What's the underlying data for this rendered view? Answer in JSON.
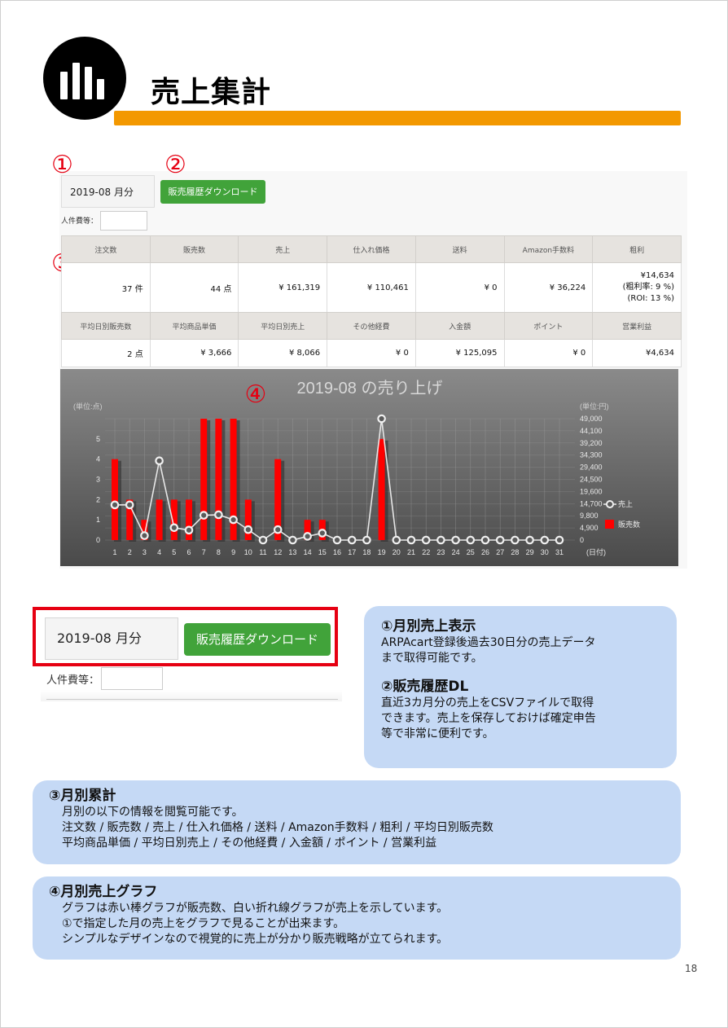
{
  "page": {
    "title": "売上集計",
    "page_number": "18"
  },
  "markers": [
    "①",
    "②",
    "③",
    "④"
  ],
  "ui": {
    "month_label": "2019-08 月分",
    "download_label": "販売履歴ダウンロード",
    "person_cost_label": "人件費等："
  },
  "stats_row1": {
    "headers": [
      "注文数",
      "販売数",
      "売上",
      "仕入れ価格",
      "送料",
      "Amazon手数料",
      "粗利"
    ],
    "values": [
      "37 件",
      "44 点",
      "¥ 161,319",
      "¥ 110,461",
      "¥ 0",
      "¥ 36,224",
      "¥14,634"
    ],
    "gross_profit_rate": "(粗利率: 9 %)",
    "roi": "(ROI: 13 %)"
  },
  "stats_row2": {
    "headers": [
      "平均日別販売数",
      "平均商品単価",
      "平均日別売上",
      "その他経費",
      "入金額",
      "ポイント",
      "営業利益"
    ],
    "values": [
      "2 点",
      "¥ 3,666",
      "¥ 8,066",
      "¥ 0",
      "¥ 125,095",
      "¥ 0",
      "¥4,634"
    ]
  },
  "chart_data": {
    "type": "bar",
    "title": "2019-08 の売り上げ",
    "left_axis_unit": "(単位:点)",
    "right_axis_unit": "(単位:円)",
    "xlabel": "(日付)",
    "categories": [
      "1",
      "2",
      "3",
      "4",
      "5",
      "6",
      "7",
      "8",
      "9",
      "10",
      "11",
      "12",
      "13",
      "14",
      "15",
      "16",
      "17",
      "18",
      "19",
      "20",
      "21",
      "22",
      "23",
      "24",
      "25",
      "26",
      "27",
      "28",
      "29",
      "30",
      "31"
    ],
    "left_ticks": [
      "0",
      "1",
      "2",
      "3",
      "4",
      "5"
    ],
    "right_ticks": [
      "0",
      "4,900",
      "9,800",
      "14,700",
      "19,600",
      "24,500",
      "29,400",
      "34,300",
      "39,200",
      "44,100",
      "49,000"
    ],
    "ylim_left": [
      0,
      6
    ],
    "ylim_right": [
      0,
      49000
    ],
    "series": [
      {
        "name": "販売数",
        "type": "bar",
        "axis": "left",
        "color": "#ff0000",
        "values": [
          4,
          2,
          1,
          2,
          2,
          2,
          6,
          6,
          6,
          2,
          0,
          4,
          0,
          1,
          1,
          0,
          0,
          0,
          5,
          0,
          0,
          0,
          0,
          0,
          0,
          0,
          0,
          0,
          0,
          0,
          0
        ]
      },
      {
        "name": "売上",
        "type": "line",
        "axis": "right",
        "color": "#e8e8e8",
        "values": [
          14200,
          14200,
          1800,
          32000,
          5000,
          4000,
          10000,
          10200,
          8200,
          4200,
          0,
          4200,
          0,
          1500,
          2800,
          0,
          0,
          0,
          49000,
          0,
          0,
          0,
          0,
          0,
          0,
          0,
          0,
          0,
          0,
          0,
          0
        ]
      }
    ],
    "legend": [
      "売上",
      "販売数"
    ],
    "legend_position": "right",
    "grid": true
  },
  "boxes": [
    {
      "head": "①月別売上表示",
      "lines": [
        "ARPAcart登録後過去30日分の売上データ",
        "まで取得可能です。"
      ]
    },
    {
      "head": "②販売履歴DL",
      "lines": [
        "直近3カ月分の売上をCSVファイルで取得",
        "できます。売上を保存しておけば確定申告",
        "等で非常に便利です。"
      ]
    },
    {
      "head": "③月別累計",
      "lines": [
        "月別の以下の情報を閲覧可能です。",
        "注文数 / 販売数 / 売上 / 仕入れ価格 / 送料 / Amazon手数料  / 粗利 / 平均日別販売数",
        "平均商品単価 / 平均日別売上 / その他経費 / 入金額 / ポイント / 営業利益"
      ]
    },
    {
      "head": "④月別売上グラフ",
      "lines": [
        "グラフは赤い棒グラフが販売数、白い折れ線グラフが売上を示しています。",
        "①で指定した月の売上をグラフで見ることが出来ます。",
        "シンプルなデザインなので視覚的に売上が分かり販売戦略が立てられます。"
      ]
    }
  ]
}
